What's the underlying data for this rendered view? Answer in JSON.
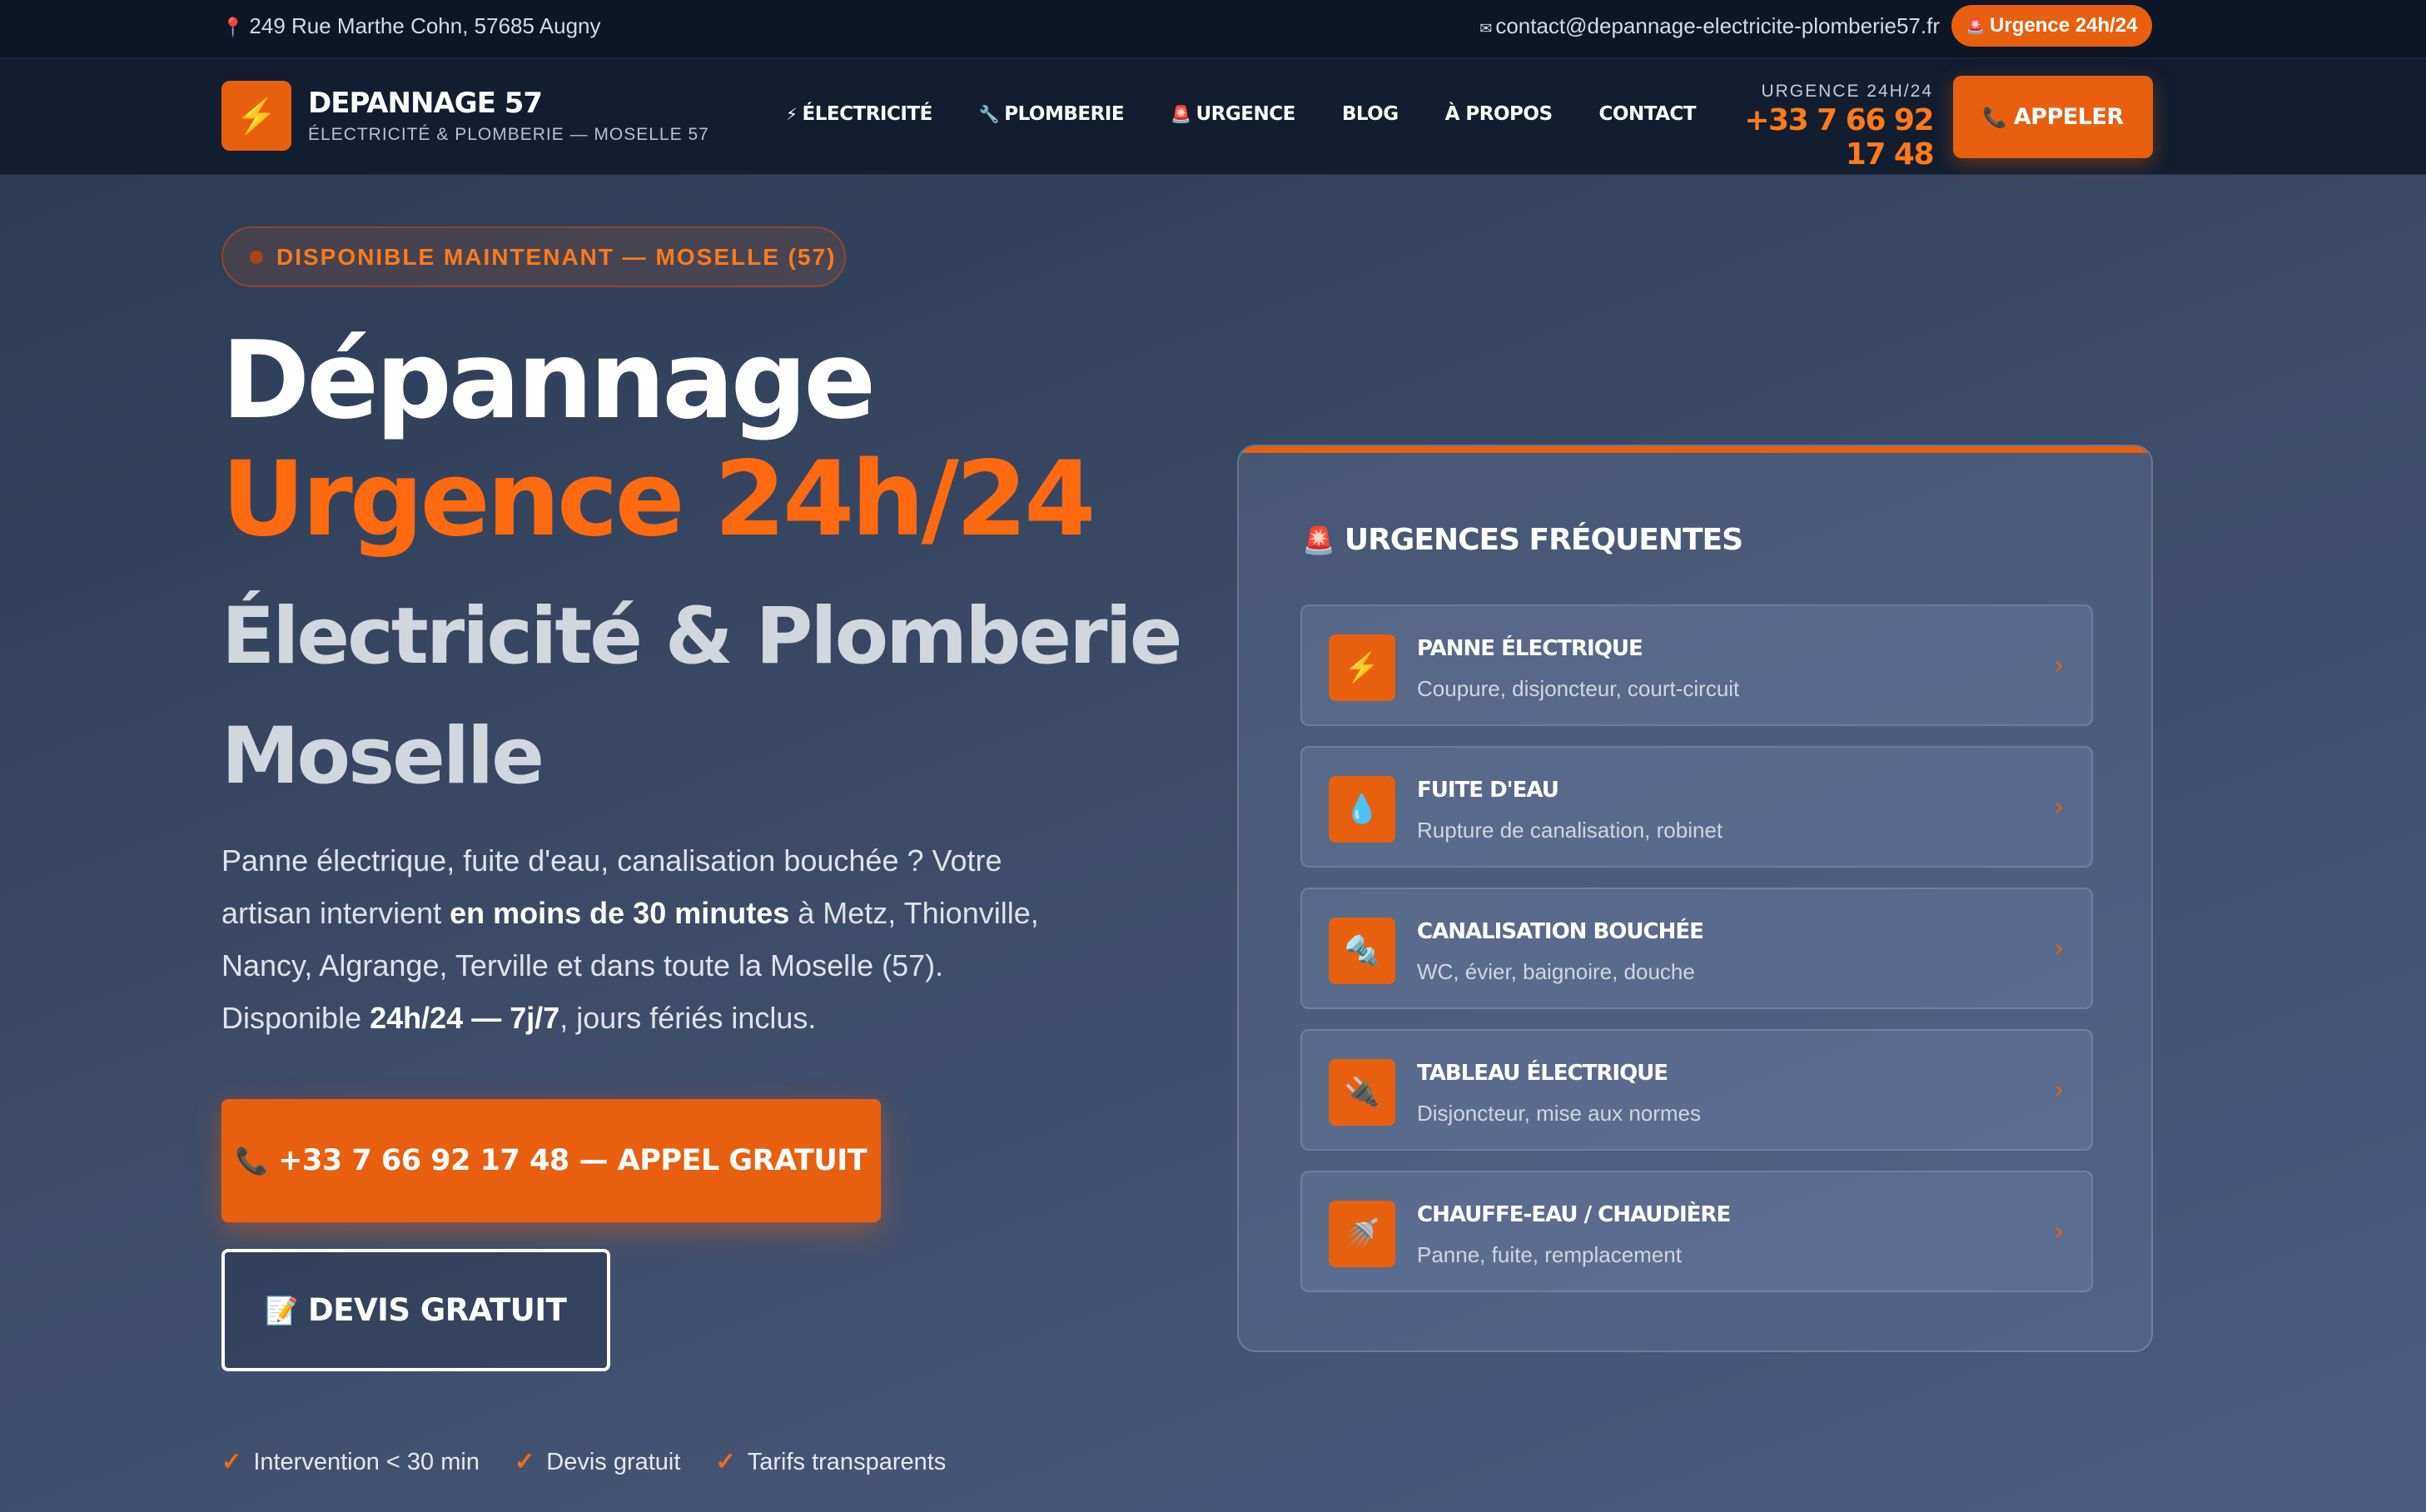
{
  "topbar": {
    "address": "249 Rue Marthe Cohn, 57685 Augny",
    "email": "contact@depannage-electricite-plomberie57.fr",
    "urgent_pill": "Urgence 24h/24"
  },
  "header": {
    "brand_name": "DEPANNAGE 57",
    "brand_sub": "ÉLECTRICITÉ & PLOMBERIE — MOSELLE 57",
    "nav": [
      {
        "label": "ÉLECTRICITÉ",
        "icon": "⚡"
      },
      {
        "label": "PLOMBERIE",
        "icon": "🔧"
      },
      {
        "label": "URGENCE",
        "icon": "🚨"
      },
      {
        "label": "BLOG",
        "icon": ""
      },
      {
        "label": "À PROPOS",
        "icon": ""
      },
      {
        "label": "CONTACT",
        "icon": ""
      }
    ],
    "phone_label": "URGENCE 24H/24",
    "phone_number": "+33 7 66 92 17 48",
    "call_button": "APPELER"
  },
  "hero": {
    "badge": "DISPONIBLE MAINTENANT — MOSELLE (57)",
    "title_line1": "Dépannage",
    "title_line2": "Urgence 24h/24",
    "title_line3": "Électricité & Plomberie",
    "title_line4": "Moselle",
    "lead_part1": "Panne électrique, fuite d'eau, canalisation bouchée ? Votre artisan intervient ",
    "lead_bold1": "en moins de 30 minutes",
    "lead_part2": " à Metz, Thionville, Nancy, Algrange, Terville et dans toute la Moselle (57). Disponible ",
    "lead_bold2": "24h/24 — 7j/7",
    "lead_part3": ", jours fériés inclus.",
    "cta_main": "+33 7 66 92 17 48 — APPEL GRATUIT",
    "cta_secondary": "DEVIS GRATUIT",
    "trust": [
      "Intervention < 30 min",
      "Devis gratuit",
      "Tarifs transparents"
    ]
  },
  "panel": {
    "title": "URGENCES FRÉQUENTES",
    "items": [
      {
        "title": "PANNE ÉLECTRIQUE",
        "desc": "Coupure, disjoncteur, court-circuit",
        "icon": "⚡"
      },
      {
        "title": "FUITE D'EAU",
        "desc": "Rupture de canalisation, robinet",
        "icon": "💧"
      },
      {
        "title": "CANALISATION BOUCHÉE",
        "desc": "WC, évier, baignoire, douche",
        "icon": "🔩"
      },
      {
        "title": "TABLEAU ÉLECTRIQUE",
        "desc": "Disjoncteur, mise aux normes",
        "icon": "🔌"
      },
      {
        "title": "CHAUFFE-EAU / CHAUDIÈRE",
        "desc": "Panne, fuite, remplacement",
        "icon": "🚿"
      }
    ]
  },
  "colors": {
    "accent": "#e8600f",
    "bg_dark": "#0d1626",
    "header_bg": "#121d30"
  }
}
